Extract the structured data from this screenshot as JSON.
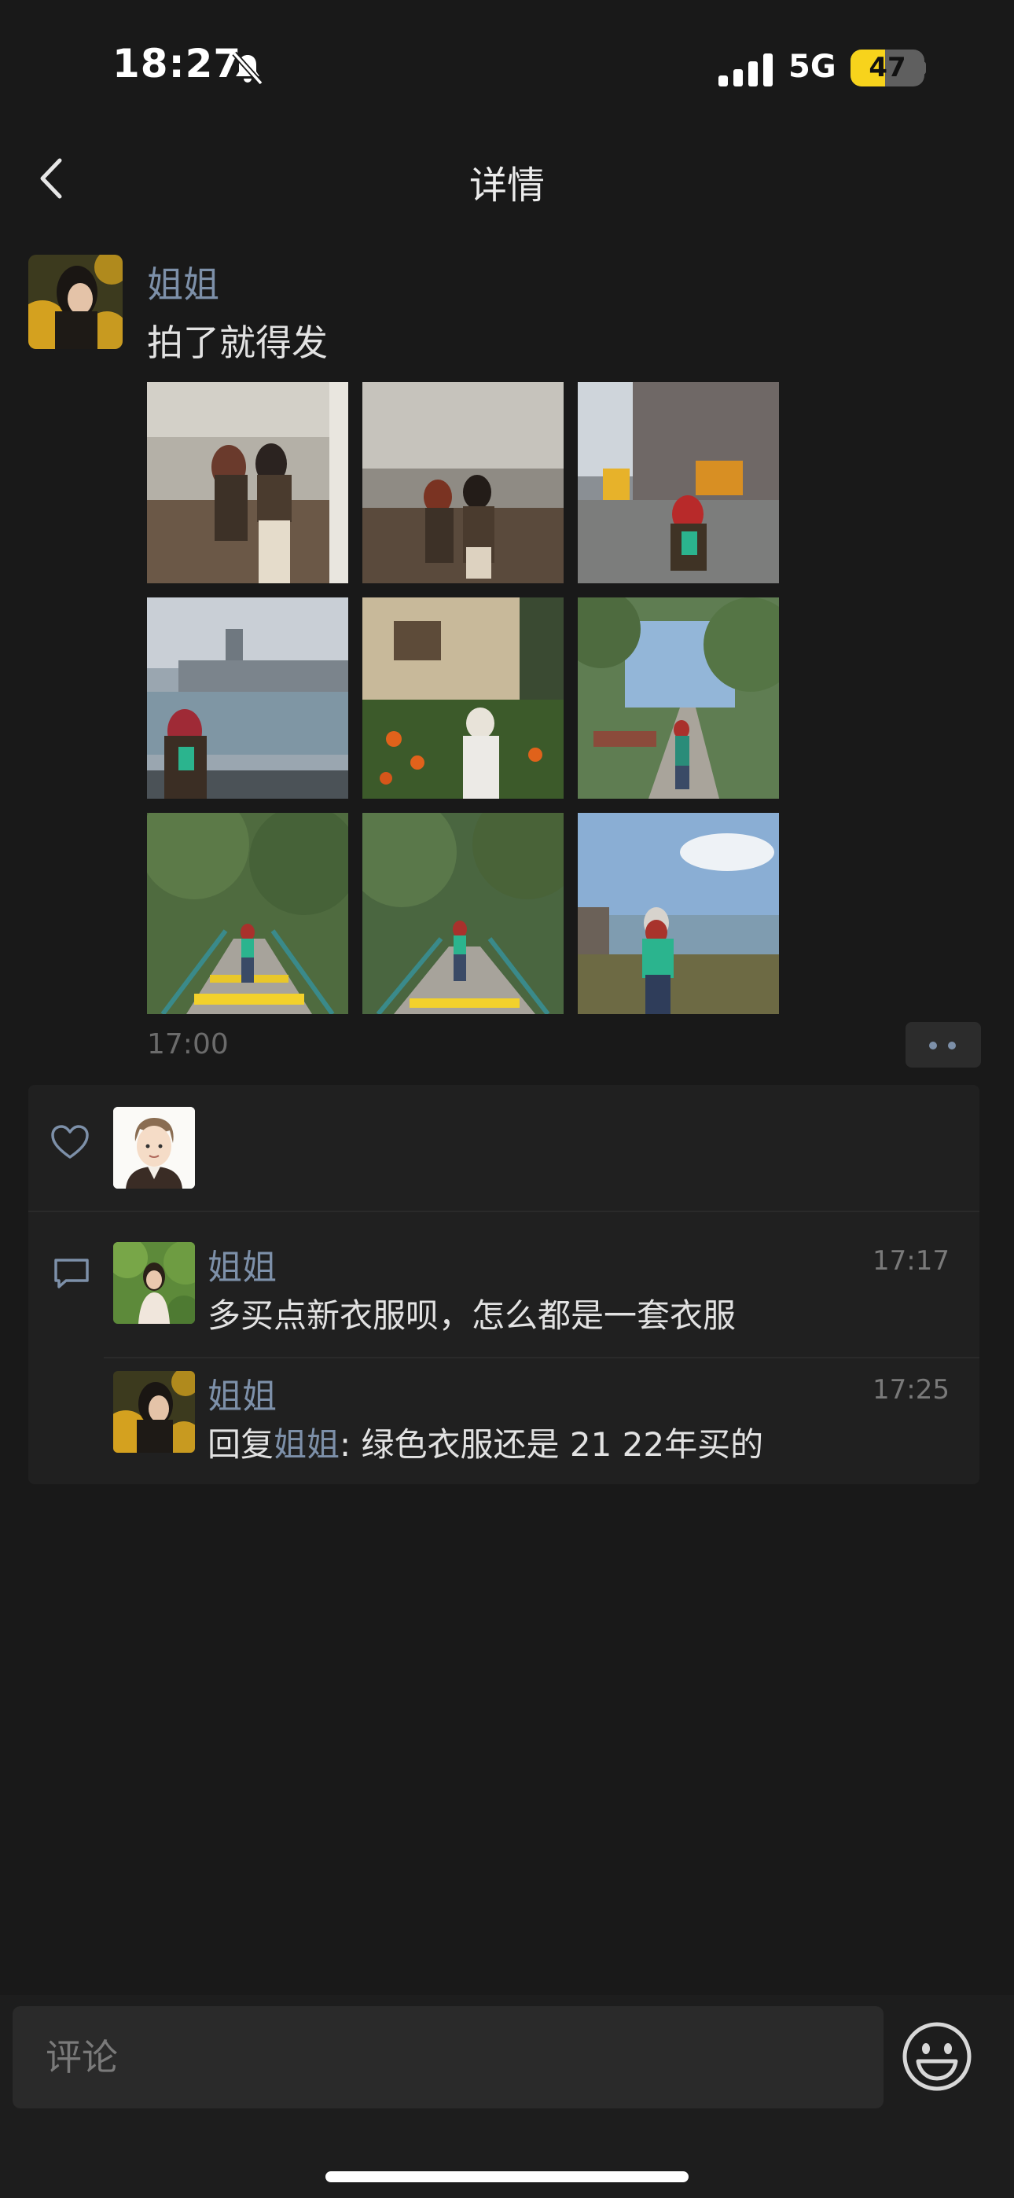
{
  "status_bar": {
    "time": "18:27",
    "network": "5G",
    "battery": "47",
    "battery_level": 0.47
  },
  "nav": {
    "title": "详情"
  },
  "post": {
    "author": "姐姐",
    "text": "拍了就得发",
    "time": "17:00",
    "photo_count": 9
  },
  "comments": [
    {
      "name": "姐姐",
      "time": "17:17",
      "text": "多买点新衣服呗，怎么都是一套衣服"
    },
    {
      "name": "姐姐",
      "time": "17:25",
      "reply_prefix": "回复",
      "reply_to": "姐姐",
      "text": ": 绿色衣服还是 21  22年买的"
    }
  ],
  "input": {
    "placeholder": "评论"
  },
  "icons": {
    "back": "chevron-left-icon",
    "bell": "bell-slash-icon",
    "like": "heart-icon",
    "comment": "comment-bubble-icon",
    "emoji": "smiley-face-icon",
    "more": "two-dots-icon"
  },
  "colors": {
    "background": "#191919",
    "name_link": "#7d90a9",
    "battery": "#f7d31c",
    "panel": "#202020",
    "input": "#2a2a2a"
  }
}
